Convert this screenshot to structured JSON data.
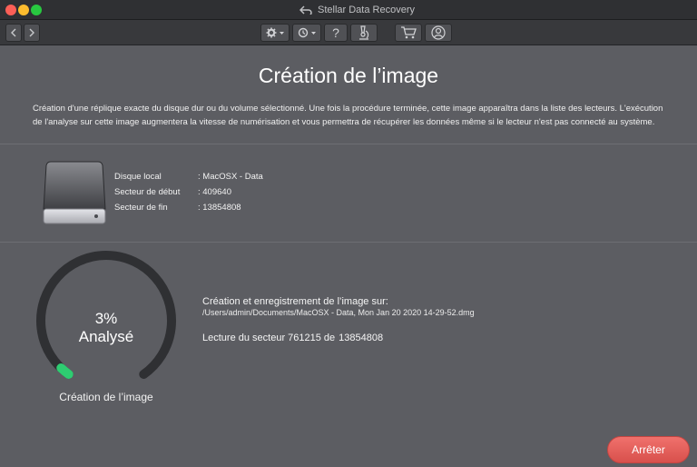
{
  "window": {
    "app_title": "Stellar Data Recovery"
  },
  "toolbar": {
    "back_icon": "chevron-left-icon",
    "forward_icon": "chevron-right-icon",
    "settings_icon": "gear-icon",
    "history_icon": "history-icon",
    "help_label": "?",
    "scan_icon": "microscope-icon",
    "cart_icon": "cart-icon",
    "account_icon": "user-icon"
  },
  "header": {
    "title": "Création de l’image",
    "description": "Création d'une réplique exacte du disque dur ou du volume sélectionné. Une fois la procédure terminée, cette image apparaîtra dans la liste des lecteurs. L'exécution de l'analyse sur cette image augmentera la vitesse de numérisation et vous permettra de récupérer les données même si le lecteur n'est pas connecté au système."
  },
  "disk": {
    "fields": [
      {
        "label": "Disque local",
        "value": ": MacOSX - Data"
      },
      {
        "label": "Secteur de début",
        "value": ": 409640"
      },
      {
        "label": "Secteur de fin",
        "value": ": 13854808"
      }
    ]
  },
  "progress": {
    "percent_text": "3%",
    "percent_value": 3,
    "status_label": "Analysé",
    "caption": "Création de l’image",
    "save_heading": "Création et enregistrement de l’image sur:",
    "save_path": "/Users/admin/Documents/MacOSX - Data, Mon Jan 20 2020 14-29-52.dmg",
    "sector_label": "Lecture du secteur 761215 de",
    "sector_total": "13854808"
  },
  "actions": {
    "stop_label": "Arrêter"
  },
  "colors": {
    "ring_track": "#2f3033",
    "ring_progress": "#2ecc71",
    "stop_button": "#e35f5a"
  }
}
